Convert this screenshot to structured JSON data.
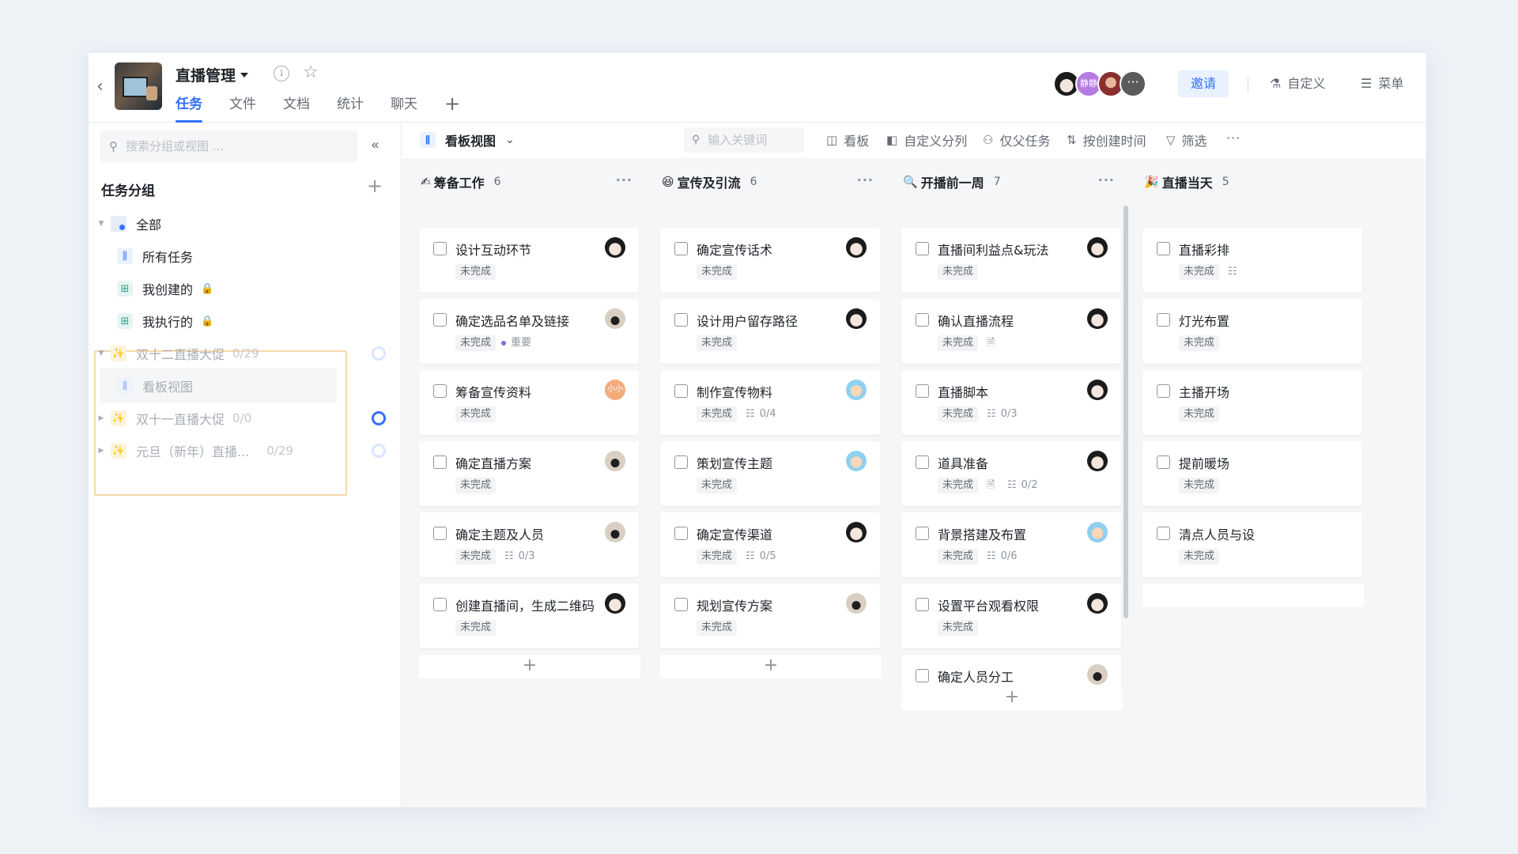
{
  "header": {
    "project_title": "直播管理",
    "tabs": [
      "任务",
      "文件",
      "文档",
      "统计",
      "聊天"
    ],
    "active_tab": "任务",
    "avatars": [
      {
        "type": "photo-dark",
        "text": ""
      },
      {
        "type": "purple",
        "text": "静静"
      },
      {
        "type": "photo-red",
        "text": ""
      },
      {
        "type": "more",
        "text": "···"
      }
    ],
    "invite_label": "邀请",
    "customize_label": "自定义",
    "menu_label": "菜单"
  },
  "sidebar": {
    "search_placeholder": "搜索分组或视图 ...",
    "group_title": "任务分组",
    "items": [
      {
        "label": "全部",
        "icon": "all-icon"
      },
      {
        "label": "所有任务",
        "icon": "kanban-icon"
      },
      {
        "label": "我创建的",
        "icon": "table-icon"
      },
      {
        "label": "我执行的",
        "icon": "table-icon"
      }
    ],
    "projects": [
      {
        "label": "双十二直播大促",
        "count": "0/29",
        "progress": 0
      },
      {
        "label": "看板视图"
      },
      {
        "label": "双十一直播大促",
        "count": "0/0",
        "progress": 0
      },
      {
        "label": "元旦（新年）直播...",
        "count": "0/29",
        "progress": 0
      }
    ]
  },
  "toolbar": {
    "view_name": "看板视图",
    "keyword_placeholder": "输入关键词",
    "buttons": [
      "看板",
      "自定义分列",
      "仅父任务",
      "按创建时间",
      "筛选"
    ]
  },
  "columns": [
    {
      "emoji": "✍",
      "title": "筹备工作",
      "count": "6",
      "cards": [
        {
          "title": "设计互动环节",
          "status": "未完成",
          "meta": "",
          "avatar": "dark"
        },
        {
          "title": "确定选品名单及链接",
          "status": "未完成",
          "meta": "重要",
          "avatar": "bag"
        },
        {
          "title": "筹备宣传资料",
          "status": "未完成",
          "meta": "",
          "avatar": "orange",
          "avatar_text": "小小"
        },
        {
          "title": "确定直播方案",
          "status": "未完成",
          "meta": "",
          "avatar": "bag"
        },
        {
          "title": "确定主题及人员",
          "status": "未完成",
          "meta": "0/3",
          "avatar": "bag"
        },
        {
          "title": "创建直播间，生成二维码",
          "status": "未完成",
          "meta": "",
          "avatar": "dark"
        }
      ]
    },
    {
      "emoji": "😆",
      "title": "宣传及引流",
      "count": "6",
      "cards": [
        {
          "title": "确定宣传话术",
          "status": "未完成",
          "meta": "",
          "avatar": "dark"
        },
        {
          "title": "设计用户留存路径",
          "status": "未完成",
          "meta": "",
          "avatar": "dark"
        },
        {
          "title": "制作宣传物料",
          "status": "未完成",
          "meta": "0/4",
          "avatar": "cute"
        },
        {
          "title": "策划宣传主题",
          "status": "未完成",
          "meta": "",
          "avatar": "cute"
        },
        {
          "title": "确定宣传渠道",
          "status": "未完成",
          "meta": "0/5",
          "avatar": "dark"
        },
        {
          "title": "规划宣传方案",
          "status": "未完成",
          "meta": "",
          "avatar": "bag"
        }
      ]
    },
    {
      "emoji": "🔍",
      "title": "开播前一周",
      "count": "7",
      "cards": [
        {
          "title": "直播间利益点&玩法",
          "status": "未完成",
          "meta": "",
          "avatar": "dark"
        },
        {
          "title": "确认直播流程",
          "status": "未完成",
          "meta": "",
          "avatar": "dark",
          "note": true
        },
        {
          "title": "直播脚本",
          "status": "未完成",
          "meta": "0/3",
          "avatar": "dark"
        },
        {
          "title": "道具准备",
          "status": "未完成",
          "meta": "0/2",
          "avatar": "dark",
          "note": true
        },
        {
          "title": "背景搭建及布置",
          "status": "未完成",
          "meta": "0/6",
          "avatar": "cute"
        },
        {
          "title": "设置平台观看权限",
          "status": "未完成",
          "meta": "",
          "avatar": "dark"
        },
        {
          "title": "确定人员分工",
          "status": "",
          "meta": "",
          "avatar": "bag"
        }
      ]
    },
    {
      "emoji": "🎉",
      "title": "直播当天",
      "count": "5",
      "cards": [
        {
          "title": "直播彩排",
          "status": "未完成",
          "meta": "",
          "avatar": ""
        },
        {
          "title": "灯光布置",
          "status": "未完成",
          "meta": "",
          "avatar": ""
        },
        {
          "title": "主播开场",
          "status": "未完成",
          "meta": "",
          "avatar": ""
        },
        {
          "title": "提前暖场",
          "status": "未完成",
          "meta": "",
          "avatar": ""
        },
        {
          "title": "清点人员与设",
          "status": "未完成",
          "meta": "",
          "avatar": ""
        }
      ]
    }
  ],
  "icons": {
    "back": "chevron-left-icon",
    "info": "info-icon",
    "star": "star-icon",
    "search": "search-icon",
    "collapse": "double-chevron-left-icon",
    "more": "more-icon",
    "add": "plus-icon"
  }
}
